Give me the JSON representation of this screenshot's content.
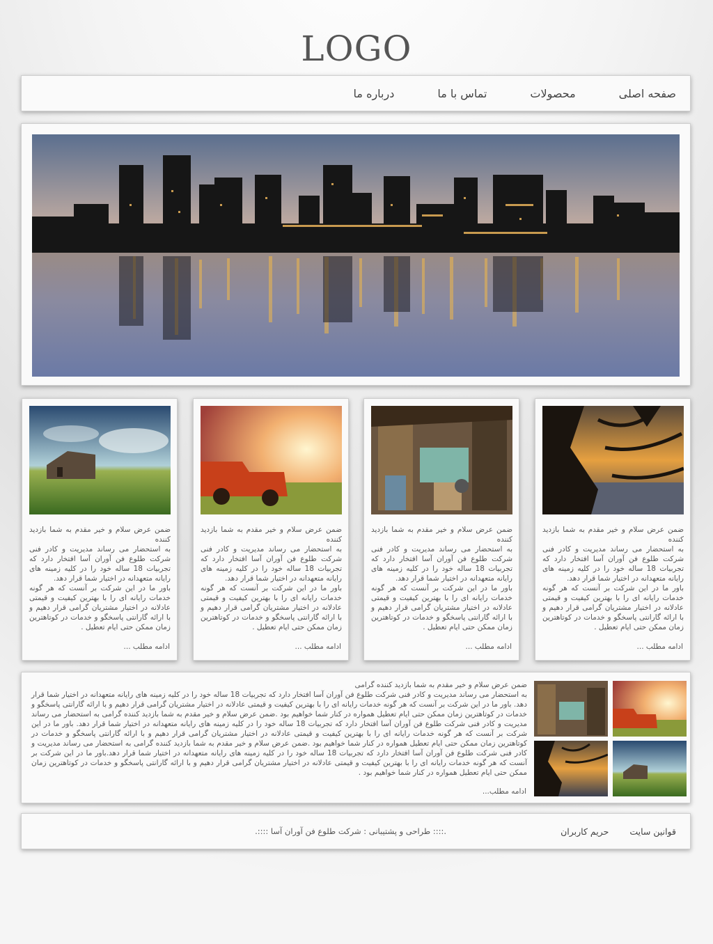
{
  "logo": "LOGO",
  "nav": {
    "home": "صفحه اصلی",
    "products": "محصولات",
    "contact": "تماس با ما",
    "about": "درباره ما"
  },
  "banner": {
    "image": "city-skyline-night-reflection"
  },
  "card_text": {
    "p1": "ضمن عرض سلام و خیر مقدم به شما بازدید کننده",
    "p2": "به استحضار می رساند مدیریت و کادر فنی شرکت طلوع فن آوران آسا افتخار دارد که تجربیات 18 ساله خود را در کلیه زمینه های رایانه متعهدانه در اختیار شما قرار دهد.",
    "p3": "باور ما در این شرکت بر آنست که هر گونه خدمات رایانه ای را با بهترین کیفیت و قیمتی عادلانه در اختیار مشتریان گرامی قرار دهیم و با ارائه گارانتی پاسخگو و خدمات در کوتاهترین زمان ممکن حتی ایام تعطیل .",
    "more": "ادامه مطلب ..."
  },
  "cards": [
    {
      "image": "sunset-tree-silhouette"
    },
    {
      "image": "workshop-interior"
    },
    {
      "image": "red-truck-field"
    },
    {
      "image": "house-green-field"
    }
  ],
  "wide": {
    "heading": "ضمن عرض سلام و خیر مقدم به شما بازدید کننده گرامی",
    "body": "به استحضار می رساند مدیریت و کادر فنی شرکت طلوع فن آوران آسا افتخار دارد که تجربیات 18 ساله خود را در کلیه زمینه های رایانه متعهدانه در اختیار شما قرار دهد. باور ما در این شرکت بر آنست که هر گونه خدمات رایانه ای را با بهترین کیفیت و قیمتی عادلانه در اختیار مشتریان گرامی قرار دهیم و با ارائه گارانتی پاسخگو و خدمات در کوتاهترین زمان ممکن حتی ایام تعطیل همواره در کنار شما خواهیم بود .ضمن عرض سلام و خیر مقدم به شما بازدید کننده گرامی به استحضار می رساند مدیریت و کادر فنی شرکت طلوع فن آوران آسا افتخار دارد که تجربیات 18 ساله خود را در کلیه زمینه های رایانه متعهدانه در اختیار شما قرار دهد. باور ما در این شرکت بر آنست که هر گونه خدمات رایانه ای را با بهترین کیفیت و قیمتی عادلانه در اختیار مشتریان گرامی قرار دهیم و با ارائه گارانتی پاسخگو و خدمات در کوتاهترین زمان ممکن حتی ایام تعطیل همواره در کنار شما خواهیم بود .ضمن عرض سلام و خیر مقدم به شما بازدید کننده گرامی به استحضار می رساند مدیریت و کادر فنی شرکت طلوع فن آوران آسا افتخار دارد که تجربیات 18 ساله خود را در کلیه زمینه های رایانه متعهدانه در اختیار شما قرار دهد.باور ما در این شرکت بر آنست که هر گونه خدمات رایانه ای را با بهترین کیفیت و قیمتی عادلانه در اختیار مشتریان گرامی قرار دهیم و با ارائه گارانتی پاسخگو و خدمات در کوتاهترین زمان ممکن حتی ایام تعطیل همواره در کنار شما خواهیم بود .",
    "more": "ادامه مطلب...",
    "thumbnails": [
      "red-truck-field",
      "workshop-interior",
      "house-green-field",
      "sunset-tree-silhouette"
    ]
  },
  "footer": {
    "terms": "قوانین سایت",
    "privacy": "حریم کاربران",
    "credit": ".:::: طراحی و پشتیبانی : شرکت طلوع فن آوران آسا ::::."
  }
}
